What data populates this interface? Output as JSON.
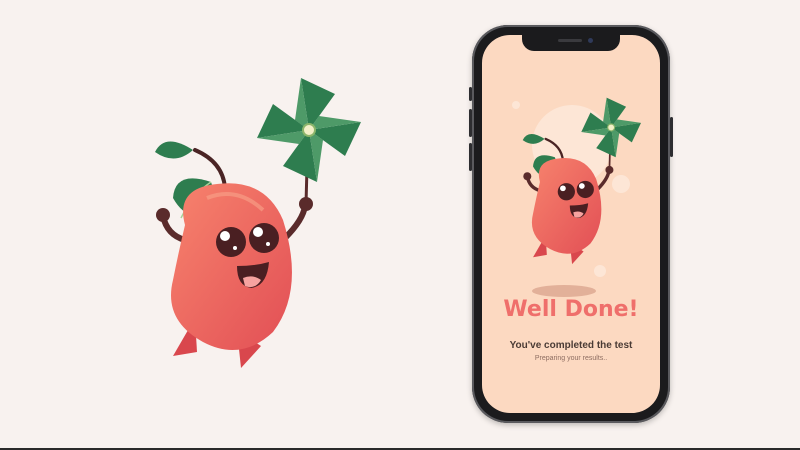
{
  "screen": {
    "title": "Well Done!",
    "subtitle": "You've completed the test",
    "status": "Preparing your results.."
  },
  "illustration": {
    "character": "red-mango-mascot",
    "prop": "pinwheel-icon"
  },
  "colors": {
    "background": "#f8f2ef",
    "screen_background": "#fcd9c1",
    "accent": "#ef6f6b",
    "mascot_body": "#f06a5c",
    "leaf": "#2e7d4f",
    "phone_frame": "#1b1b1d"
  }
}
